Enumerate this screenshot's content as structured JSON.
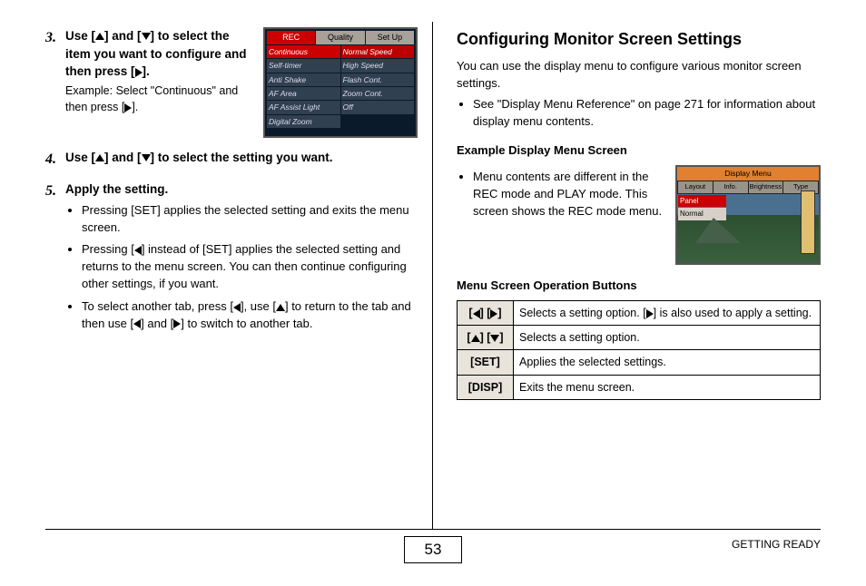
{
  "page_number": "53",
  "footer_label": "GETTING READY",
  "left": {
    "steps": [
      {
        "num": "3.",
        "title_parts": [
          "Use [",
          "] and [",
          "] to select the item you want to configure and then press [",
          "]."
        ],
        "note_parts": [
          "Example: Select \"Continuous\" and then press [",
          "]."
        ]
      },
      {
        "num": "4.",
        "title_parts": [
          "Use [",
          "] and [",
          "] to select the setting you want."
        ]
      },
      {
        "num": "5.",
        "title": "Apply the setting.",
        "bullets": [
          {
            "parts": [
              "Pressing [SET] applies the selected setting and exits the menu screen."
            ]
          },
          {
            "parts": [
              "Pressing [",
              "] instead of [SET] applies the selected setting and returns to the menu screen. You can then continue configuring other settings, if you want."
            ]
          },
          {
            "parts": [
              "To select another tab, press [",
              "], use [",
              "] to return to the tab and then use [",
              "] and [",
              "] to switch to another tab."
            ]
          }
        ]
      }
    ],
    "rec_menu": {
      "tabs": [
        "REC",
        "Quality",
        "Set Up"
      ],
      "left_col": [
        "Continuous",
        "Self-timer",
        "Anti Shake",
        "AF Area",
        "AF Assist Light",
        "Digital Zoom"
      ],
      "right_col": [
        "Normal Speed",
        "High Speed",
        "Flash Cont.",
        "Zoom Cont.",
        "Off"
      ]
    }
  },
  "right": {
    "heading": "Configuring Monitor Screen Settings",
    "intro": "You can use the display menu to configure various monitor screen settings.",
    "intro_bullet": "See \"Display Menu Reference\" on page 271 for information about display menu contents.",
    "example_head": "Example Display Menu Screen",
    "example_bullet": "Menu contents are different in the REC mode and PLAY mode. This screen shows the REC mode menu.",
    "display_menu": {
      "title": "Display Menu",
      "tabs": [
        "Layout",
        "Info.",
        "Brightness",
        "Type"
      ],
      "items": [
        "Panel",
        "Normal"
      ]
    },
    "ops_head": "Menu Screen Operation Buttons",
    "ops": [
      {
        "key_arrows": [
          "left",
          "right"
        ],
        "desc_parts": [
          "Selects a setting option. [",
          "] is also used to apply a setting."
        ]
      },
      {
        "key_arrows": [
          "up",
          "down"
        ],
        "desc_parts": [
          "Selects a setting option."
        ]
      },
      {
        "key_text": "[SET]",
        "desc_parts": [
          "Applies the selected settings."
        ]
      },
      {
        "key_text": "[DISP]",
        "desc_parts": [
          "Exits the menu screen."
        ]
      }
    ]
  }
}
